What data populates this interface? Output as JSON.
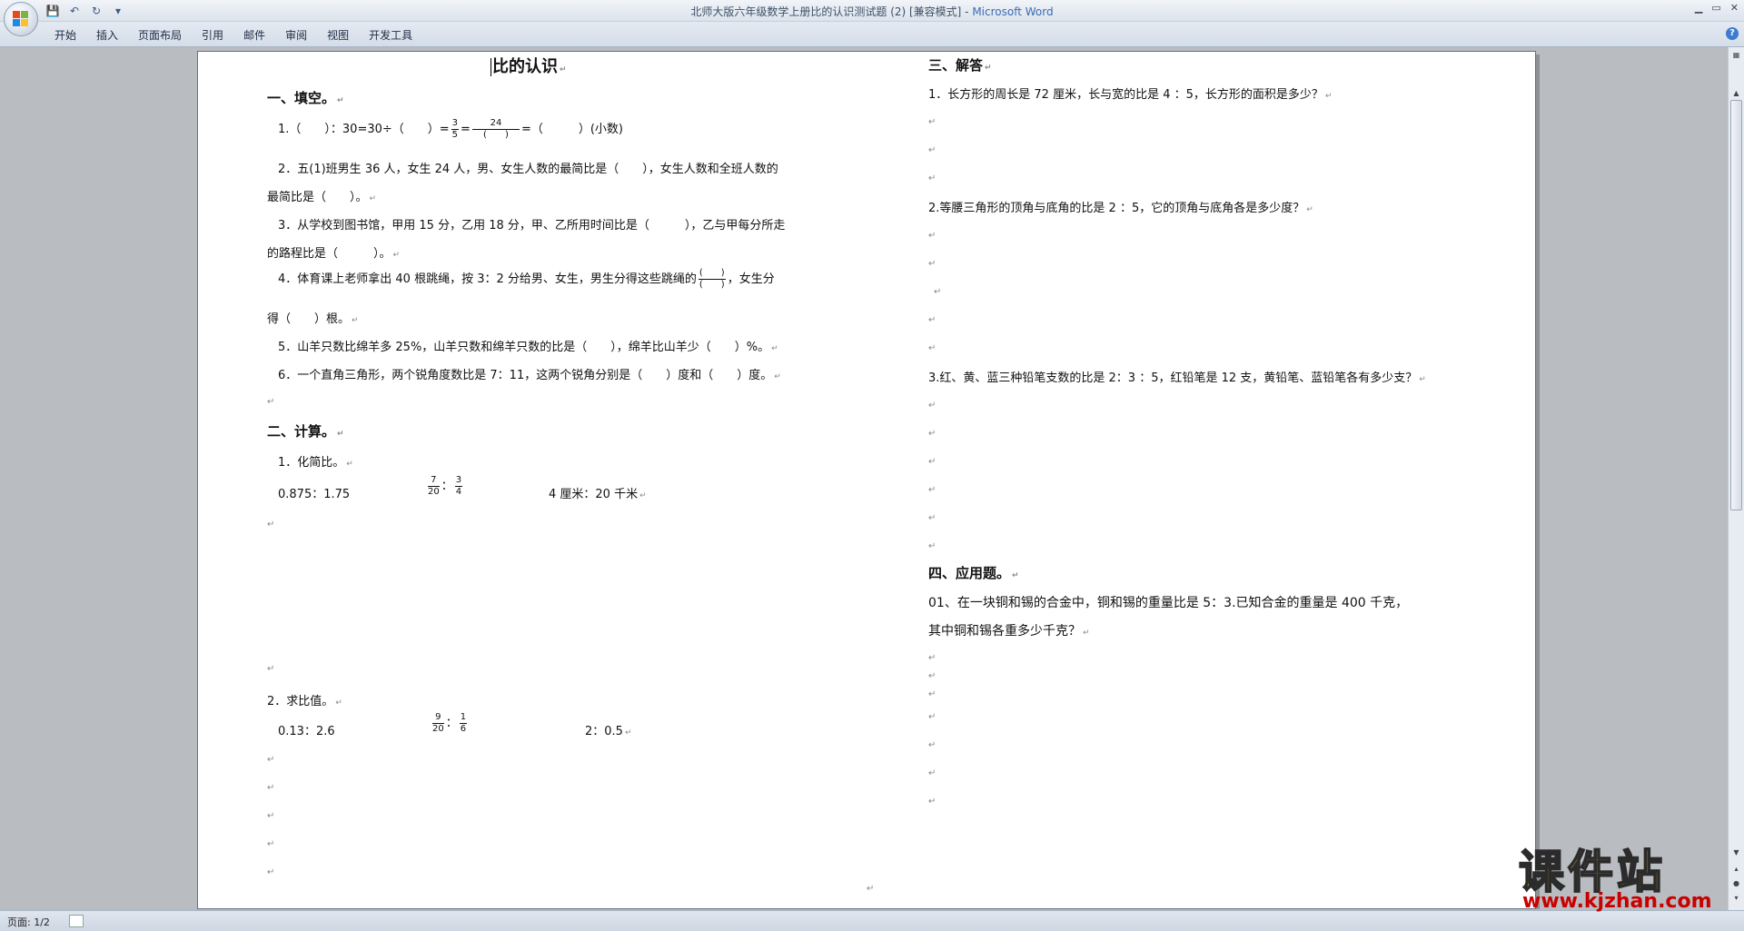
{
  "window": {
    "title": "北师大版六年级数学上册比的认识测试题 (2) [兼容模式] - ",
    "app_name": "Microsoft Word"
  },
  "qat": {
    "save_icon": "💾",
    "undo_icon": "↶",
    "redo_icon": "↻",
    "customize_icon": "▾"
  },
  "ribbon": {
    "tabs": [
      "开始",
      "插入",
      "页面布局",
      "引用",
      "邮件",
      "审阅",
      "视图",
      "开发工具"
    ],
    "help": "?"
  },
  "document": {
    "title": "比的认识",
    "section1": {
      "heading": "一、填空。",
      "q1_a": "1.（　　）：30=30÷（　　）=",
      "q1_f1_num": "3",
      "q1_f1_den": "5",
      "q1_eq": "=",
      "q1_f2_num": "24",
      "q1_f2_den": "(　　)",
      "q1_b": "=（　　　）(小数)",
      "q2_l1": "2．五(1)班男生 36 人，女生 24 人，男、女生人数的最简比是（　　），女生人数和全班人数的",
      "q2_l2": "最简比是（　　）。",
      "q3_l1": "3．从学校到图书馆，甲用 15 分，乙用 18 分，甲、乙所用时间比是（　　　），乙与甲每分所走",
      "q3_l2": "的路程比是（　　　）。",
      "q4_l1a": "4．体育课上老师拿出 40 根跳绳，按 3：2 分给男、女生，男生分得这些跳绳的",
      "q4_f_num": "(　　)",
      "q4_f_den": "(　　)",
      "q4_l1b": "，女生分",
      "q4_l2": "得（　　）根。",
      "q5": "5．山羊只数比绵羊多 25%，山羊只数和绵羊只数的比是（　　），绵羊比山羊少（　　）%。",
      "q6": "6．一个直角三角形，两个锐角度数比是 7：11，这两个锐角分别是（　　）度和（　　）度。"
    },
    "section2": {
      "heading": "二、计算。",
      "sub1": "1．化简比。",
      "s1_a": "0.875：1.75",
      "s1_b_num1": "7",
      "s1_b_den1": "20",
      "s1_b_colon": "：",
      "s1_b_num2": "3",
      "s1_b_den2": "4",
      "s1_c": "4 厘米：20 千米",
      "sub2": "2．求比值。",
      "s2_a": "0.13：2.6",
      "s2_b_num1": "9",
      "s2_b_den1": "20",
      "s2_b_colon": "：",
      "s2_b_num2": "1",
      "s2_b_den2": "6",
      "s2_c": "2：0.5"
    },
    "section3": {
      "heading": "三、解答",
      "q1": "1．长方形的周长是 72 厘米，长与宽的比是 4 ：5，长方形的面积是多少？",
      "q2": "2.等腰三角形的顶角与底角的比是 2 ：5，它的顶角与底角各是多少度？",
      "q3": "3.红、黄、蓝三种铅笔支数的比是 2：3 ：5，红铅笔是 12 支，黄铅笔、蓝铅笔各有多少支？"
    },
    "section4": {
      "heading": "四、应用题。",
      "q1_l1": "01、在一块铜和锡的合金中，铜和锡的重量比是 5：3.已知合金的重量是 400 千克，",
      "q1_l2": "其中铜和锡各重多少千克？"
    },
    "para_mark": "↵"
  },
  "status": {
    "page": "页面: 1/2"
  },
  "watermark": {
    "title": "课件站",
    "url": "www.kjzhan.com"
  },
  "colors": {
    "accent": "#3a6bb4",
    "watermark_yellow": "#f2c500",
    "watermark_red": "#c80000"
  }
}
